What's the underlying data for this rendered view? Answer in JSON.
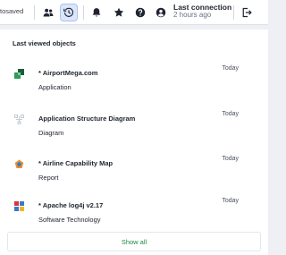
{
  "topbar": {
    "autosaved_text": "tosaved",
    "buttons": [
      {
        "icon": "users-icon"
      },
      {
        "icon": "history-icon",
        "active": true
      },
      {
        "icon": "bell-icon"
      },
      {
        "icon": "star-icon"
      },
      {
        "icon": "help-icon"
      },
      {
        "icon": "user-circle-icon"
      },
      {
        "icon": "logout-icon"
      }
    ],
    "last_connection_label": "Last connection",
    "last_connection_value": "2 hours ago"
  },
  "panel": {
    "title": "Last viewed objects",
    "items": [
      {
        "name": "* AirportMega.com",
        "type": "Application",
        "date": "Today",
        "icon": "application-icon"
      },
      {
        "name": "Application Structure Diagram",
        "type": "Diagram",
        "date": "Today",
        "icon": "diagram-icon"
      },
      {
        "name": "* Airline Capability Map",
        "type": "Report",
        "date": "Today",
        "icon": "report-icon"
      },
      {
        "name": "* Apache log4j v2.17",
        "type": "Software Technology",
        "date": "Today",
        "icon": "software-technology-icon"
      }
    ],
    "show_all_label": "Show all"
  },
  "colors": {
    "accent_green": "#1d8a45",
    "active_button_bg": "#dbe6fb"
  }
}
